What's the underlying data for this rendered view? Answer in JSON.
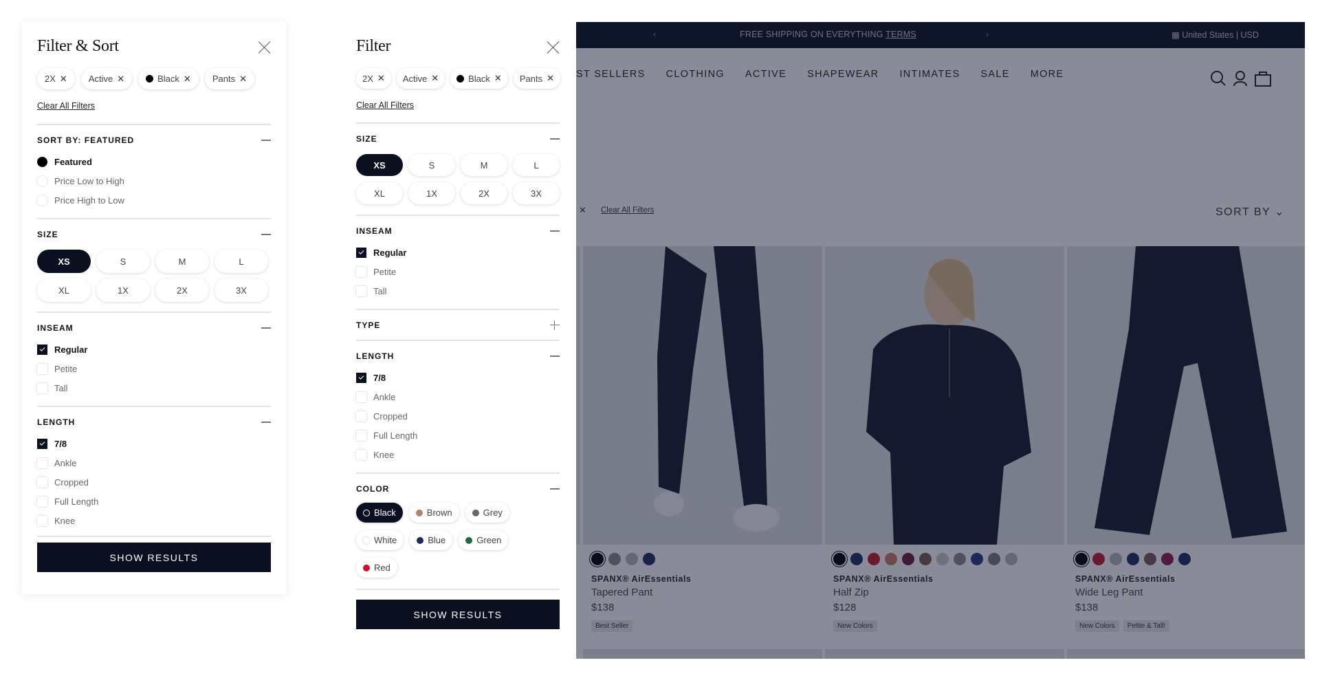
{
  "panel_a": {
    "title": "Filter & Sort",
    "chips": [
      {
        "label": "2X",
        "dot": false
      },
      {
        "label": "Active",
        "dot": false
      },
      {
        "label": "Black",
        "dot": true
      },
      {
        "label": "Pants",
        "dot": false
      }
    ],
    "clear_all": "Clear All Filters",
    "sort": {
      "heading": "SORT BY: FEATURED",
      "options": [
        {
          "label": "Featured",
          "selected": true
        },
        {
          "label": "Price Low to High",
          "selected": false
        },
        {
          "label": "Price High to Low",
          "selected": false
        }
      ]
    },
    "size": {
      "heading": "SIZE",
      "options": [
        {
          "label": "XS",
          "selected": true
        },
        {
          "label": "S",
          "selected": false
        },
        {
          "label": "M",
          "selected": false
        },
        {
          "label": "L",
          "selected": false
        },
        {
          "label": "XL",
          "selected": false
        },
        {
          "label": "1X",
          "selected": false
        },
        {
          "label": "2X",
          "selected": false
        },
        {
          "label": "3X",
          "selected": false
        }
      ]
    },
    "inseam": {
      "heading": "INSEAM",
      "options": [
        {
          "label": "Regular",
          "checked": true
        },
        {
          "label": "Petite",
          "checked": false
        },
        {
          "label": "Tall",
          "checked": false
        }
      ]
    },
    "length": {
      "heading": "LENGTH",
      "options": [
        {
          "label": "7/8",
          "checked": true
        },
        {
          "label": "Ankle",
          "checked": false
        },
        {
          "label": "Cropped",
          "checked": false
        },
        {
          "label": "Full Length",
          "checked": false
        },
        {
          "label": "Knee",
          "checked": false
        }
      ]
    },
    "show_results": "SHOW RESULTS"
  },
  "panel_b": {
    "title": "Filter",
    "chips": [
      {
        "label": "2X",
        "dot": false
      },
      {
        "label": "Active",
        "dot": false
      },
      {
        "label": "Black",
        "dot": true
      },
      {
        "label": "Pants",
        "dot": false
      }
    ],
    "clear_all": "Clear All Filters",
    "size": {
      "heading": "SIZE",
      "options": [
        {
          "label": "XS",
          "selected": true
        },
        {
          "label": "S",
          "selected": false
        },
        {
          "label": "M",
          "selected": false
        },
        {
          "label": "L",
          "selected": false
        },
        {
          "label": "XL",
          "selected": false
        },
        {
          "label": "1X",
          "selected": false
        },
        {
          "label": "2X",
          "selected": false
        },
        {
          "label": "3X",
          "selected": false
        }
      ]
    },
    "inseam": {
      "heading": "INSEAM",
      "options": [
        {
          "label": "Regular",
          "checked": true
        },
        {
          "label": "Petite",
          "checked": false
        },
        {
          "label": "Tall",
          "checked": false
        }
      ]
    },
    "type": {
      "heading": "TYPE"
    },
    "length": {
      "heading": "LENGTH",
      "options": [
        {
          "label": "7/8",
          "checked": true
        },
        {
          "label": "Ankle",
          "checked": false
        },
        {
          "label": "Cropped",
          "checked": false
        },
        {
          "label": "Full Length",
          "checked": false
        },
        {
          "label": "Knee",
          "checked": false
        }
      ]
    },
    "color": {
      "heading": "COLOR",
      "options": [
        {
          "label": "Black",
          "hex": "#000000",
          "selected": true
        },
        {
          "label": "Brown",
          "hex": "#b8806a",
          "selected": false
        },
        {
          "label": "Grey",
          "hex": "#666666",
          "selected": false
        },
        {
          "label": "White",
          "hex": "#ffffff",
          "selected": false
        },
        {
          "label": "Blue",
          "hex": "#1e2a5e",
          "selected": false
        },
        {
          "label": "Green",
          "hex": "#1e6b3c",
          "selected": false
        },
        {
          "label": "Red",
          "hex": "#d0122c",
          "selected": false
        }
      ]
    },
    "show_results": "SHOW RESULTS"
  },
  "site": {
    "promo": "FREE SHIPPING ON EVERYTHING",
    "promo_link": "TERMS",
    "region": "United States | USD",
    "nav": [
      "ST SELLERS",
      "CLOTHING",
      "ACTIVE",
      "SHAPEWEAR",
      "INTIMATES",
      "SALE",
      "MORE"
    ],
    "clear_all": "Clear All Filters",
    "sort_by": "SORT BY",
    "products": [
      {
        "brand": "SPANX® AirEssentials",
        "name": "Tapered Pant",
        "price": "$138",
        "tags": [
          "Best Seller"
        ],
        "swatches": [
          "#000000",
          "#8a8a8a",
          "#b5b5b5",
          "#1e2a5e"
        ]
      },
      {
        "brand": "SPANX® AirEssentials",
        "name": "Half Zip",
        "price": "$128",
        "tags": [
          "New Colors"
        ],
        "swatches": [
          "#000000",
          "#1e2a5e",
          "#c4162a",
          "#c87a5a",
          "#6a1a3a",
          "#7a5a55",
          "#c8c8c8",
          "#8a8a8a",
          "#1e3a7e",
          "#7a7a7a",
          "#b5b5b5"
        ]
      },
      {
        "brand": "SPANX® AirEssentials",
        "name": "Wide Leg Pant",
        "price": "$138",
        "tags": [
          "New Colors",
          "Petite & Tall!"
        ],
        "swatches": [
          "#000000",
          "#c4162a",
          "#b5b5b5",
          "#1e2a5e",
          "#7a5a55",
          "#8a1a4a",
          "#1e2a5e"
        ]
      }
    ]
  },
  "colors": {
    "navy": "#0b1020",
    "overlay": "rgba(20,26,50,0.5)"
  }
}
